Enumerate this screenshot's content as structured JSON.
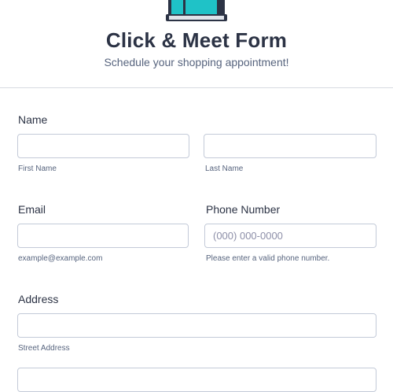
{
  "header": {
    "title": "Click & Meet Form",
    "subtitle": "Schedule your shopping appointment!",
    "logo_icon": "storefront-icon"
  },
  "fields": {
    "name": {
      "label": "Name",
      "first": {
        "value": "",
        "placeholder": "",
        "sublabel": "First Name"
      },
      "last": {
        "value": "",
        "placeholder": "",
        "sublabel": "Last Name"
      }
    },
    "email": {
      "label": "Email",
      "value": "",
      "placeholder": "",
      "sublabel": "example@example.com"
    },
    "phone": {
      "label": "Phone Number",
      "value": "",
      "placeholder": "(000) 000-0000",
      "sublabel": "Please enter a valid phone number."
    },
    "address": {
      "label": "Address",
      "street": {
        "value": "",
        "placeholder": "",
        "sublabel": "Street Address"
      },
      "line2": {
        "value": "",
        "placeholder": ""
      }
    }
  },
  "colors": {
    "text": "#2c3345",
    "sublabel": "#57647e",
    "border": "#c3cad8",
    "logo_accent": "#1fc2c7"
  }
}
